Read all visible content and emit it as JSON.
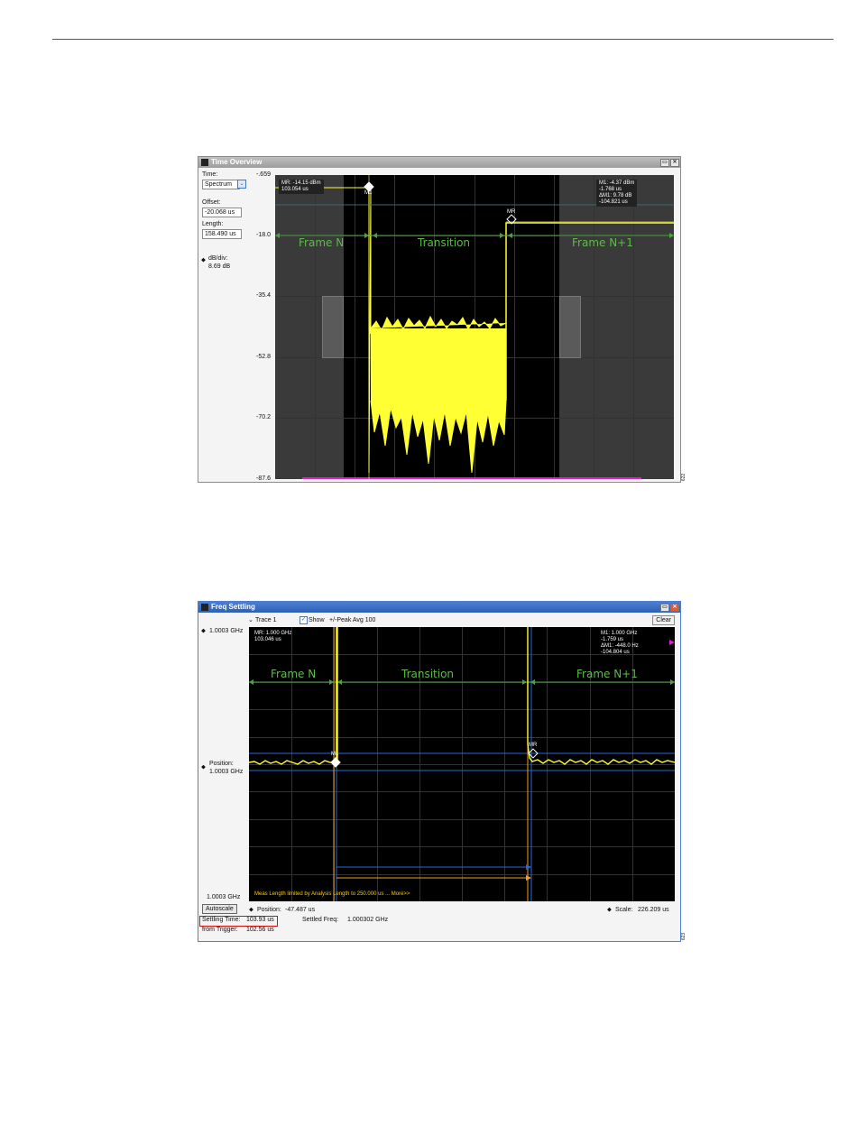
{
  "top_window": {
    "title": "Time Overview",
    "left_panel": {
      "time_label": "Time:",
      "time_value": "Spectrum",
      "offset_label": "Offset:",
      "offset_value": "-20.068 us",
      "length_label": "Length:",
      "length_value": "158.490 us",
      "dbdiv_label": "dB/div:",
      "dbdiv_value": "8.69 dB"
    },
    "y_ticks": [
      "-.659",
      "-18.0",
      "-35.4",
      "-52.8",
      "-70.2",
      "-87.6"
    ],
    "marker_left": {
      "line1": "MR: -14.15 dBm",
      "line2": "103.054 us"
    },
    "marker_right": {
      "line1": "M1: -4.37 dBm",
      "line2": "-1.768 us",
      "line3": "ΔM1: 9.78 dB",
      "line4": "-104.821 us"
    },
    "m1_label": "M1",
    "mr_label": "MR",
    "frames": {
      "frame_n": "Frame N",
      "transition": "Transition",
      "frame_n1": "Frame N+1"
    },
    "side_tag": "622"
  },
  "bottom_window": {
    "title": "Freq Settling",
    "toolbar": {
      "trace": "Trace 1",
      "show": "Show",
      "avg": "+/-Peak Avg 100",
      "clear": "Clear"
    },
    "y_top": "1.0003 GHz",
    "position_label": "Position:",
    "position_value": "1.0003 GHz",
    "y_bottom": "1.0003 GHz",
    "marker_left": {
      "line1": "MR: 1.000 GHz",
      "line2": "103.046 us"
    },
    "marker_right": {
      "line1": "M1: 1.000 GHz",
      "line2": "-1.759 us",
      "line3": "ΔM1: -448.0 Hz",
      "line4": "-104.804 us"
    },
    "m1_label": "M1",
    "mr_label": "MR",
    "frames": {
      "frame_n": "Frame N",
      "transition": "Transition",
      "frame_n1": "Frame N+1"
    },
    "warning": "Meas Length limited by Analysis Length to 250.000 us ... More>>",
    "autoscale": "Autoscale",
    "x_position_label": "Position:",
    "x_position_value": "-47.487 us",
    "scale_label": "Scale:",
    "scale_value": "226.209 us",
    "settling_time_label": "Settling Time:",
    "settling_time_value": "103.93 us",
    "settled_freq_label": "Settled Freq:",
    "settled_freq_value": "1.000302 GHz",
    "from_trigger_label": "from Trigger:",
    "from_trigger_value": "102.56 us",
    "side_tag": "623"
  },
  "colors": {
    "trace": "#ffff33",
    "frame_label": "#5fb94a",
    "magenta": "#e020c8",
    "blue": "#2a66d8",
    "orange": "#f0a020",
    "highlight_box": "#d01010"
  }
}
